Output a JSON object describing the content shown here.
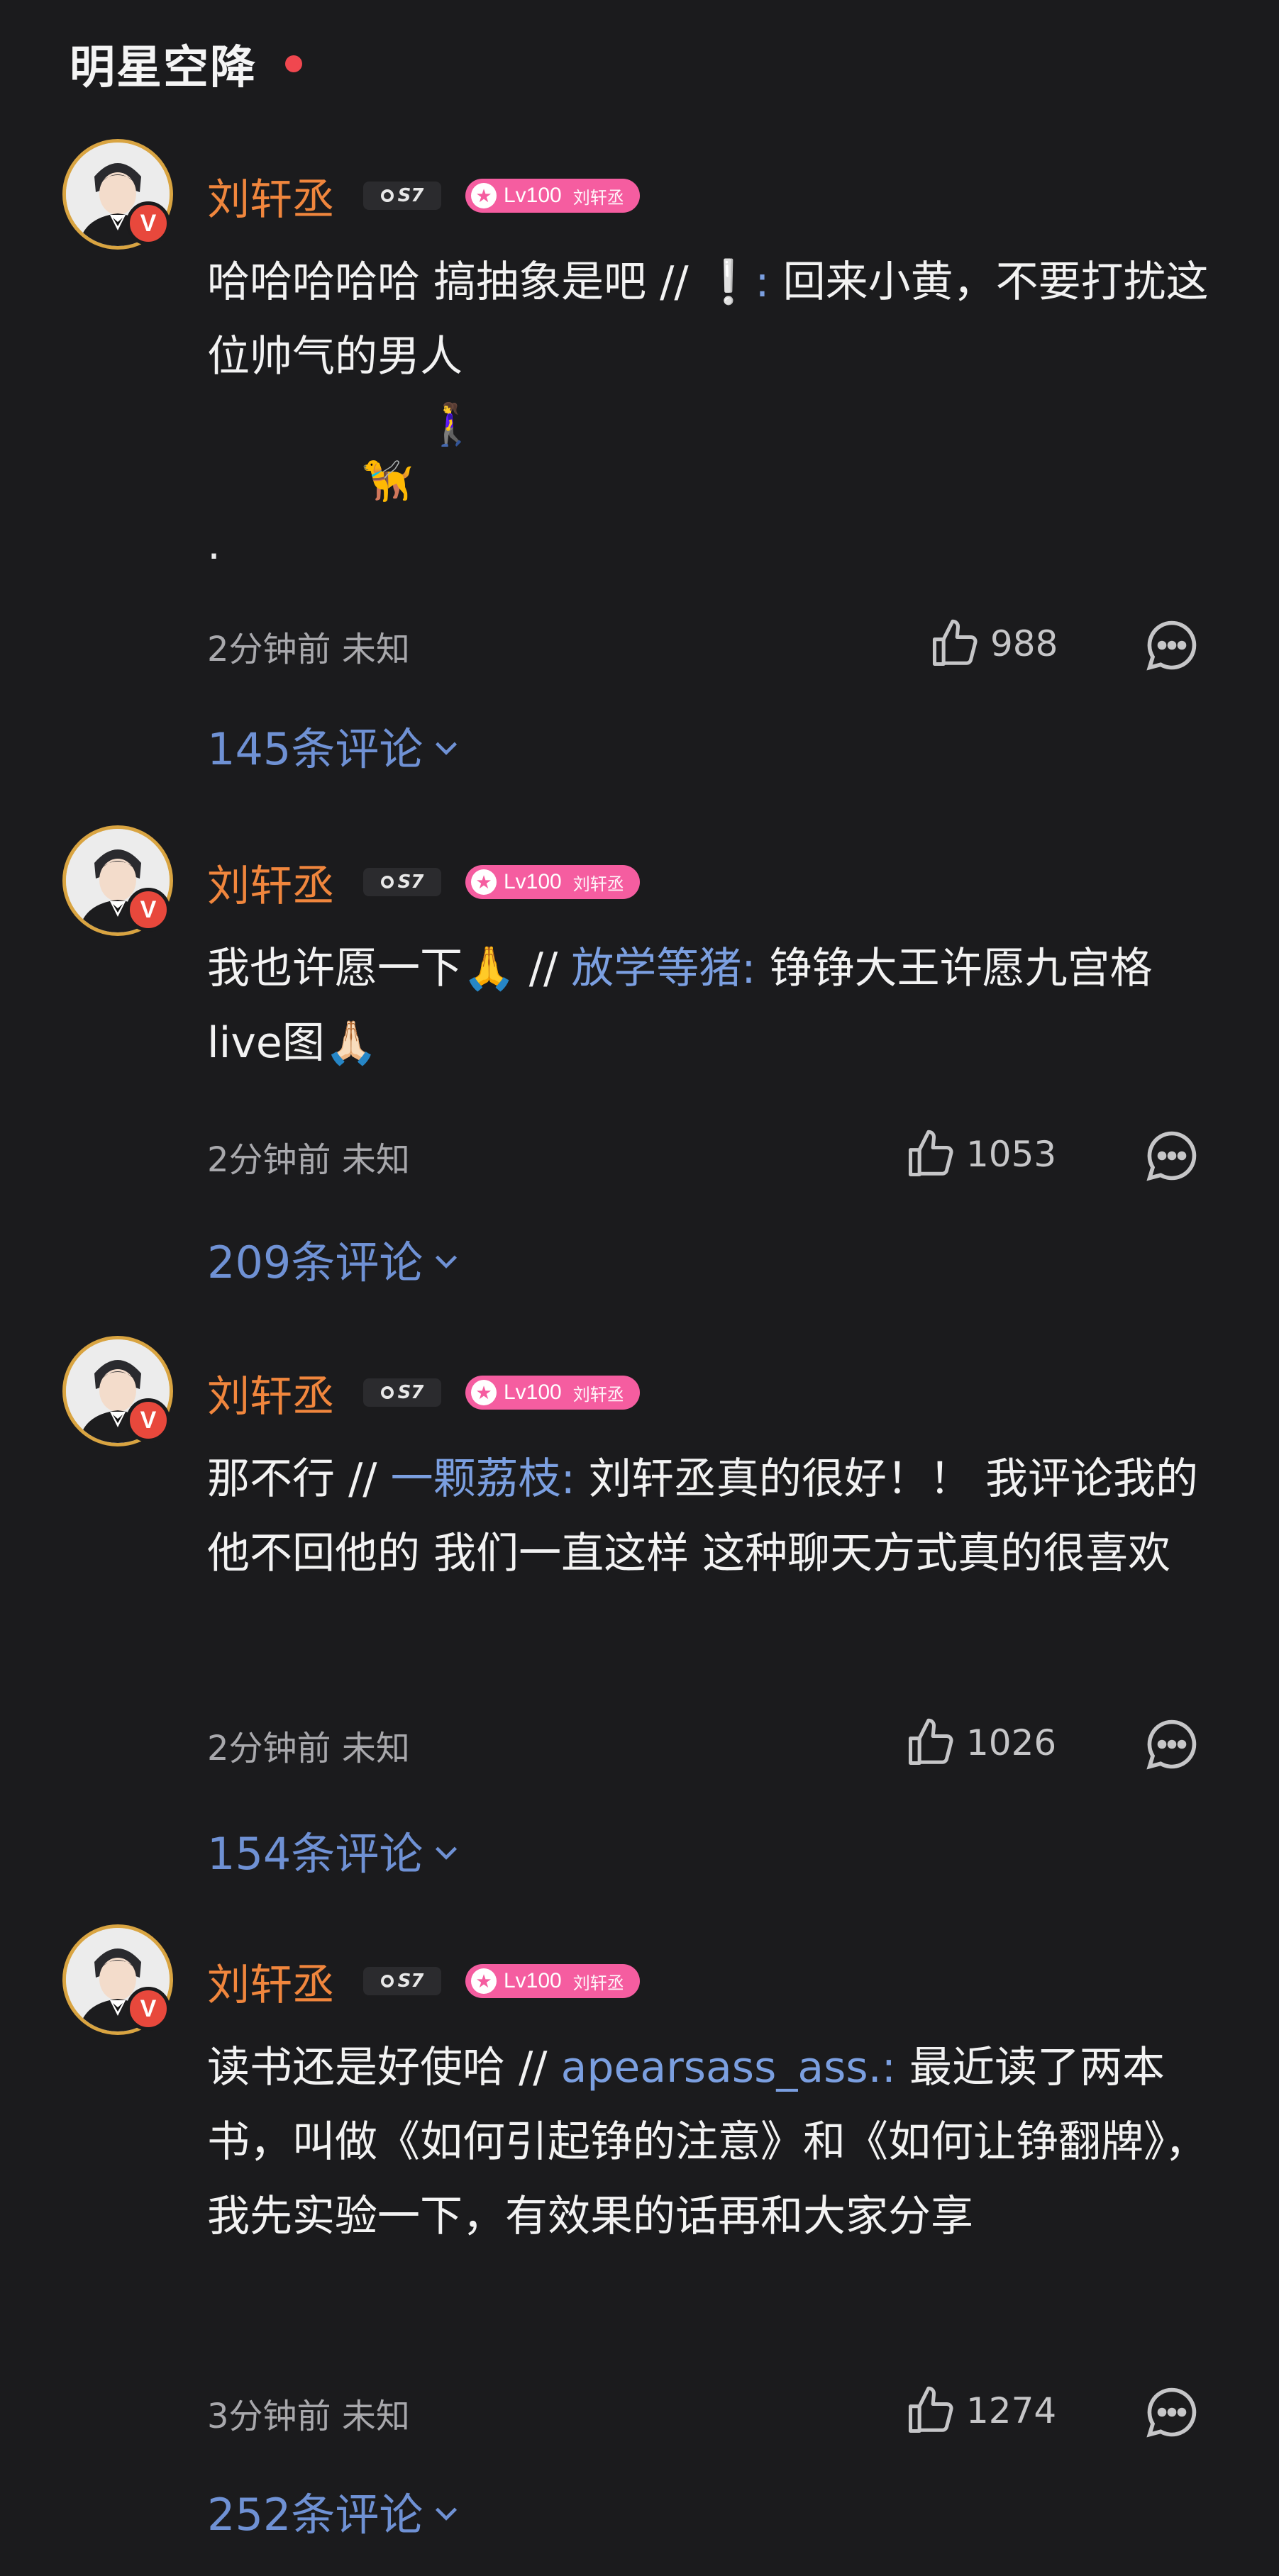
{
  "header": {
    "title": "明星空降"
  },
  "comments": [
    {
      "username": "刘轩丞",
      "fan_badge": "S7",
      "level": "Lv100",
      "level_name": "刘轩丞",
      "text_before": "哈哈哈哈哈 搞抽象是吧 // ",
      "mention": "❕:",
      "text_after": " 回来小黄，不要打扰这位帅气的男人",
      "emoji_line1": "🚶‍♀️",
      "emoji_line2": "🦮",
      "emoji_line3": ".",
      "time": "2分钟前",
      "location": "未知",
      "likes": "988",
      "replies": "145条评论"
    },
    {
      "username": "刘轩丞",
      "fan_badge": "S7",
      "level": "Lv100",
      "level_name": "刘轩丞",
      "text_before": "我也许愿一下🙏 // ",
      "mention": "放学等猪:",
      "text_after": " 铮铮大王许愿九宫格live图🙏🏻",
      "time": "2分钟前",
      "location": "未知",
      "likes": "1053",
      "replies": "209条评论"
    },
    {
      "username": "刘轩丞",
      "fan_badge": "S7",
      "level": "Lv100",
      "level_name": "刘轩丞",
      "text_before": "那不行 // ",
      "mention": "一颗荔枝:",
      "text_after": " 刘轩丞真的很好！！ 我评论我的 他不回他的 我们一直这样 这种聊天方式真的很喜欢",
      "time": "2分钟前",
      "location": "未知",
      "likes": "1026",
      "replies": "154条评论"
    },
    {
      "username": "刘轩丞",
      "fan_badge": "S7",
      "level": "Lv100",
      "level_name": "刘轩丞",
      "text_before": "读书还是好使哈 // ",
      "mention": "apearsass_ass.:",
      "text_after": " 最近读了两本书，叫做《如何引起铮的注意》和《如何让铮翻牌》，我先实验一下，有效果的话再和大家分享",
      "time": "3分钟前",
      "location": "未知",
      "likes": "1274",
      "replies": "252条评论"
    }
  ]
}
